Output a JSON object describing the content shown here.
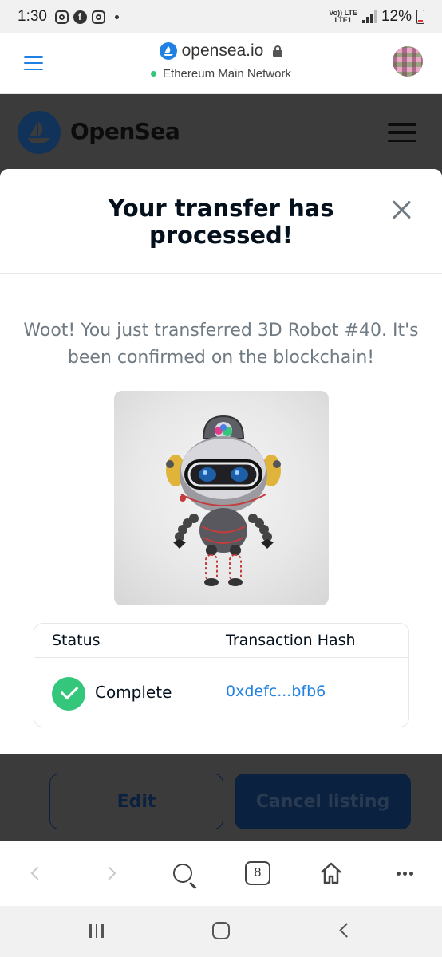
{
  "status_bar": {
    "time": "1:30",
    "network_top": "Vo)) LTE",
    "network_bottom": "LTE1",
    "battery": "12%"
  },
  "browser": {
    "domain": "opensea.io",
    "network": "Ethereum Main Network",
    "tab_count": "8"
  },
  "header": {
    "brand": "OpenSea"
  },
  "modal": {
    "title": "Your transfer has processed!",
    "message": "Woot! You just transferred 3D Robot #40. It's been confirmed on the blockchain!",
    "table": {
      "headers": [
        "Status",
        "Transaction Hash"
      ],
      "row": {
        "status": "Complete",
        "hash": "0xdefc...bfb6"
      }
    }
  },
  "actions": {
    "edit": "Edit",
    "cancel_listing": "Cancel listing"
  },
  "icons": {
    "menu": "hamburger-icon",
    "lock": "lock-icon",
    "close": "close-icon",
    "check": "check-circle-icon",
    "search": "search-icon",
    "home": "home-icon",
    "more": "more-icon"
  },
  "colors": {
    "accent": "#2081e2",
    "success": "#34c77b",
    "overlay": "#3b3b3b"
  }
}
